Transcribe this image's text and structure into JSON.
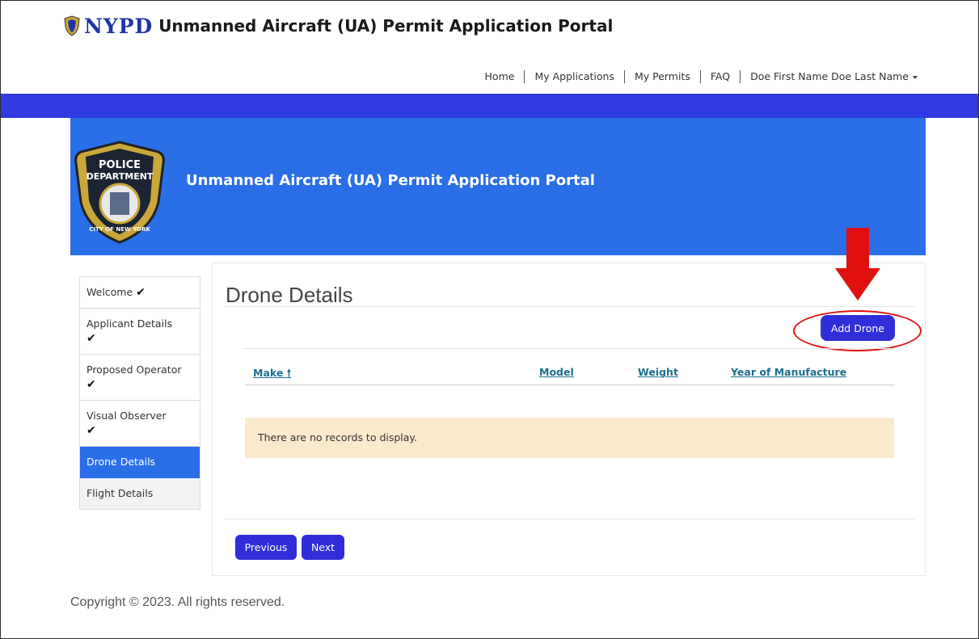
{
  "header": {
    "brand_logo_text": "NYPD",
    "brand_title": "Unmanned Aircraft (UA) Permit Application Portal"
  },
  "nav": {
    "items": [
      "Home",
      "My Applications",
      "My Permits",
      "FAQ"
    ],
    "user_name": "Doe First Name Doe Last Name"
  },
  "hero": {
    "badge_text_top": "POLICE",
    "badge_text_mid": "DEPARTMENT",
    "badge_text_city": "CITY OF NEW YORK",
    "title": "Unmanned Aircraft (UA) Permit Application Portal"
  },
  "sidebar": {
    "items": [
      {
        "label": "Welcome",
        "check": "✔"
      },
      {
        "label": "Applicant Details",
        "check": "✔"
      },
      {
        "label": "Proposed Operator",
        "check": "✔"
      },
      {
        "label": "Visual Observer",
        "check": "✔"
      },
      {
        "label": "Drone Details",
        "check": ""
      },
      {
        "label": "Flight Details",
        "check": ""
      }
    ]
  },
  "main": {
    "title": "Drone Details",
    "add_button": "Add Drone",
    "columns": [
      "Make",
      "Model",
      "Weight",
      "Year of Manufacture"
    ],
    "sort_arrow": "🠕",
    "empty_message": "There are no records to display.",
    "previous_button": "Previous",
    "next_button": "Next"
  },
  "footer": {
    "copyright": "Copyright © 2023. All rights reserved."
  },
  "colors": {
    "topbar": "#2f3be0",
    "hero": "#2a6ee8",
    "button": "#2f2ed8",
    "annotation": "#e01010",
    "link": "#1b6f8e",
    "empty_row": "#fbe9cc"
  }
}
